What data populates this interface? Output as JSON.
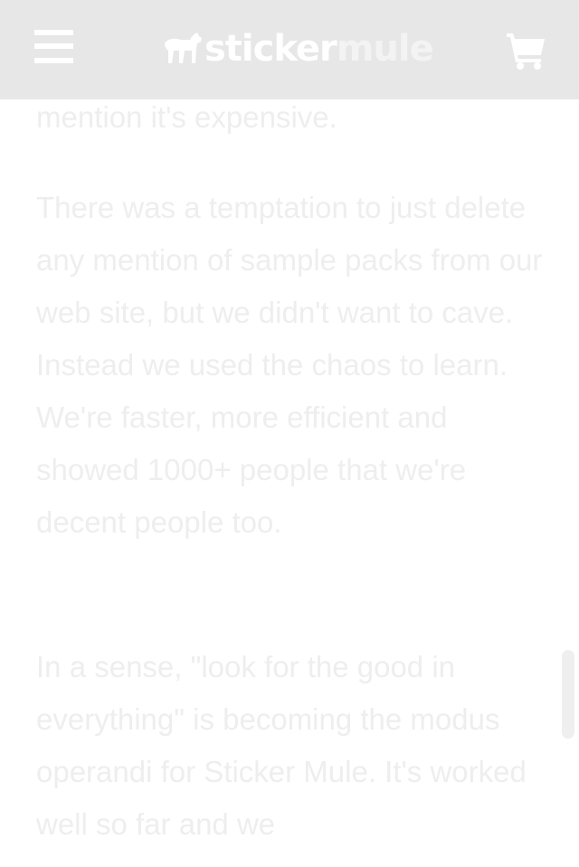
{
  "header": {
    "logo_text_primary": "sticker",
    "logo_text_secondary": "mule",
    "menu_icon": "hamburger-menu-icon",
    "cart_icon": "shopping-cart-icon"
  },
  "article": {
    "paragraph_0": "mention it's expensive.",
    "paragraph_1": "There was a temptation to just delete any mention of sample packs from our web site, but we didn't want to cave. Instead we used the chaos to learn. We're faster, more efficient and showed 1000+ people that we're decent people too.",
    "paragraph_2": "In a sense, \"look for the good in everything\" is becoming the modus operandi for Sticker Mule. It's worked well so far and we"
  },
  "colors": {
    "header_bg": "#e7e7e7",
    "header_icons": "#ffffff",
    "text": "#eeeeee",
    "page_bg": "#ffffff"
  }
}
